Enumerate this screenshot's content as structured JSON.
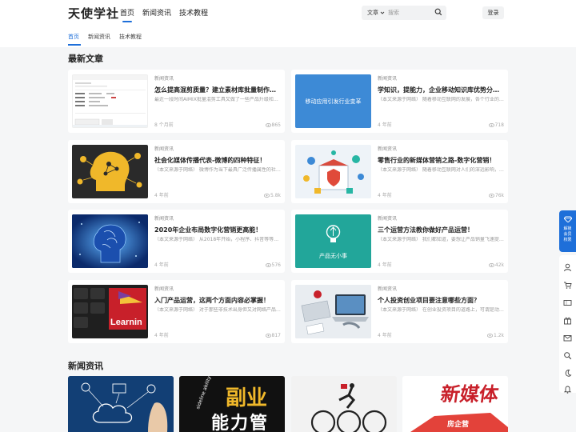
{
  "site": {
    "logo": "天使学社"
  },
  "nav": {
    "items": [
      {
        "label": "首页"
      },
      {
        "label": "新闻资讯"
      },
      {
        "label": "技术教程"
      }
    ]
  },
  "search": {
    "type_label": "文章",
    "placeholder": "搜索"
  },
  "login": {
    "label": "登录"
  },
  "subnav": {
    "items": [
      {
        "label": "首页"
      },
      {
        "label": "新闻资讯"
      },
      {
        "label": "技术教程"
      }
    ]
  },
  "sections": {
    "latest": "最新文章",
    "news": "新闻资讯"
  },
  "articles": [
    {
      "category": "新闻资讯",
      "title": "怎么提高混剪质量？建立素材库批量制作原创…",
      "excerpt": "最近一段时间AIMIX批量混剪工具又做了一些产品升级和…",
      "date": "8 个月前",
      "views": "865"
    },
    {
      "category": "新闻资讯",
      "title": "学知识，提能力，企业移动知识库优势分析！",
      "excerpt": "（本文来源于网络） 随着移动互联网的发展，各个行业的产…",
      "date": "4 年前",
      "views": "718",
      "thumb_text": "移动应用引发行业变革"
    },
    {
      "category": "新闻资讯",
      "title": "社会化媒体传播代表-微博的四种特征！",
      "excerpt": "（本文来源于网络） 微博作为当下最具广泛传播属性的社…",
      "date": "4 年前",
      "views": "5.8k"
    },
    {
      "category": "新闻资讯",
      "title": "零售行业的新媒体营销之路-数字化营销！",
      "excerpt": "（本文来源于网络） 随着移动互联网对人们的深远影响，…",
      "date": "4 年前",
      "views": "76k"
    },
    {
      "category": "新闻资讯",
      "title": "2020年企业布局数字化营销更高能！",
      "excerpt": "（本文来源于网络） 从2018年开始，小程序、抖音等等…",
      "date": "4 年前",
      "views": "576"
    },
    {
      "category": "新闻资讯",
      "title": "三个运营方法教你做好产品运营！",
      "excerpt": "（本文来源于网络） 我们都知道，要想让产品销量飞速提…",
      "date": "4 年前",
      "views": "42k",
      "thumb_text": "产品无小事"
    },
    {
      "category": "新闻资讯",
      "title": "入门产品运营，这两个方面内容必掌握！",
      "excerpt": "（本文来源于网络） 对于那些非技术出身但又对网络产品…",
      "date": "4 年前",
      "views": "817"
    },
    {
      "category": "新闻资讯",
      "title": "个人投资创业项目要注意哪些方面？",
      "excerpt": "（本文来源于网络） 在创业投资项目的道路上，可谓是动…",
      "date": "4 年前",
      "views": "1.2k"
    }
  ],
  "news_images": [
    {
      "text": ""
    },
    {
      "text": "副业",
      "text2": "能力管",
      "text3": "sideline ability"
    },
    {
      "text": ""
    },
    {
      "text": "新媒体",
      "text2": "房企营"
    }
  ],
  "sidebar": {
    "vip": "解锁会员权限"
  },
  "colors": {
    "accent": "#1e6fd9",
    "teal": "#22a69a",
    "blue_thumb": "#3d8ad6"
  }
}
